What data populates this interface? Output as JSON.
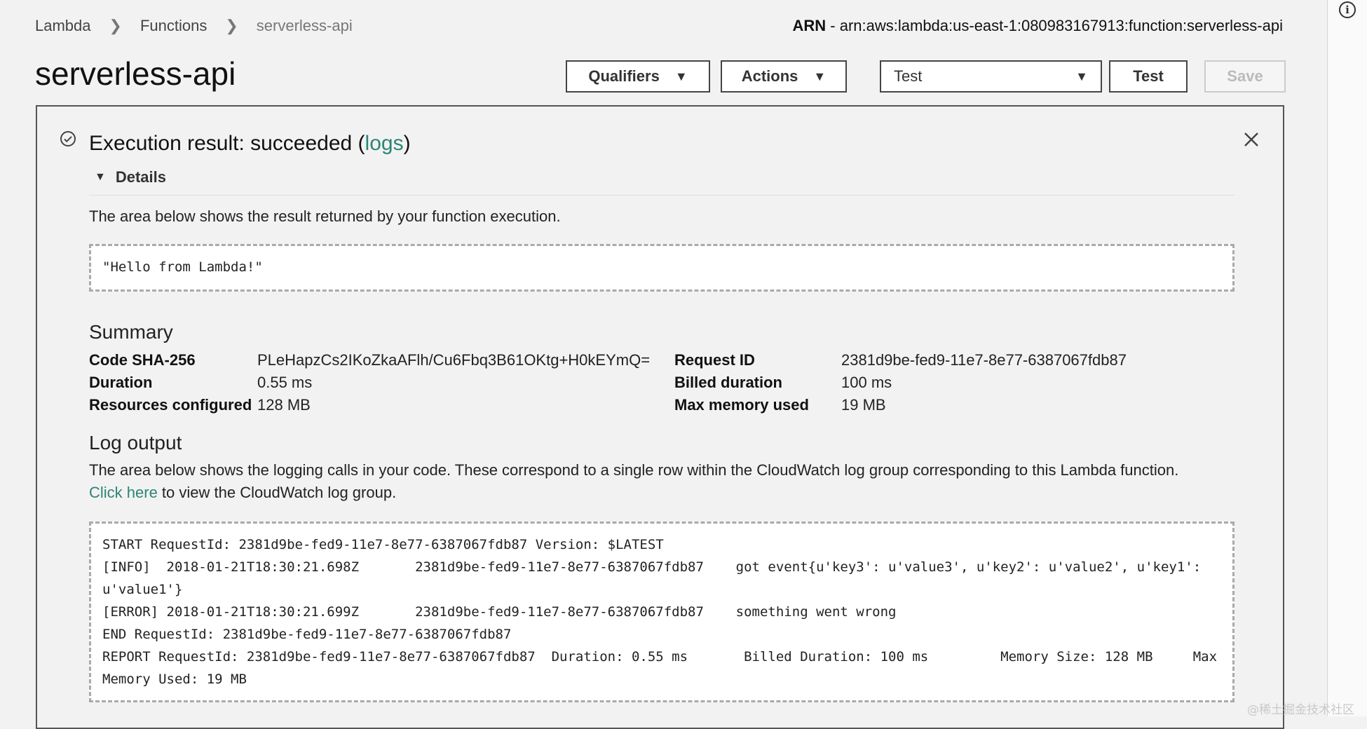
{
  "breadcrumb": {
    "items": [
      "Lambda",
      "Functions",
      "serverless-api"
    ]
  },
  "arn": {
    "label": "ARN",
    "value": " - arn:aws:lambda:us-east-1:080983167913:function:serverless-api"
  },
  "page": {
    "title": "serverless-api"
  },
  "toolbar": {
    "qualifiers_label": "Qualifiers",
    "actions_label": "Actions",
    "test_event_selected": "Test",
    "test_label": "Test",
    "save_label": "Save"
  },
  "result": {
    "title_prefix": "Execution result: succeeded (",
    "logs_link": "logs",
    "title_suffix": ")",
    "details_label": "Details",
    "description": "The area below shows the result returned by your function execution.",
    "output": "\"Hello from Lambda!\""
  },
  "summary": {
    "heading": "Summary",
    "left": [
      {
        "label": "Code SHA-256",
        "value": "PLeHapzCs2IKoZkaAFlh/Cu6Fbq3B61OKtg+H0kEYmQ="
      },
      {
        "label": "Duration",
        "value": "0.55 ms"
      },
      {
        "label": "Resources configured",
        "value": "128 MB"
      }
    ],
    "right": [
      {
        "label": "Request ID",
        "value": "2381d9be-fed9-11e7-8e77-6387067fdb87"
      },
      {
        "label": "Billed duration",
        "value": "100 ms"
      },
      {
        "label": "Max memory used",
        "value": "19 MB"
      }
    ]
  },
  "log_output": {
    "heading": "Log output",
    "description": "The area below shows the logging calls in your code. These correspond to a single row within the CloudWatch log group corresponding to this Lambda function.",
    "click_here": "Click here",
    "click_here_suffix": " to view the CloudWatch log group.",
    "lines": [
      "START RequestId: 2381d9be-fed9-11e7-8e77-6387067fdb87 Version: $LATEST",
      "[INFO]  2018-01-21T18:30:21.698Z       2381d9be-fed9-11e7-8e77-6387067fdb87    got event{u'key3': u'value3', u'key2': u'value2', u'key1':",
      "u'value1'}",
      "[ERROR] 2018-01-21T18:30:21.699Z       2381d9be-fed9-11e7-8e77-6387067fdb87    something went wrong",
      "END RequestId: 2381d9be-fed9-11e7-8e77-6387067fdb87",
      "REPORT RequestId: 2381d9be-fed9-11e7-8e77-6387067fdb87  Duration: 0.55 ms       Billed Duration: 100 ms         Memory Size: 128 MB     Max",
      "Memory Used: 19 MB"
    ]
  },
  "watermark": "@稀土掘金技术社区",
  "colors": {
    "link": "#2d8576",
    "border": "#555555"
  }
}
